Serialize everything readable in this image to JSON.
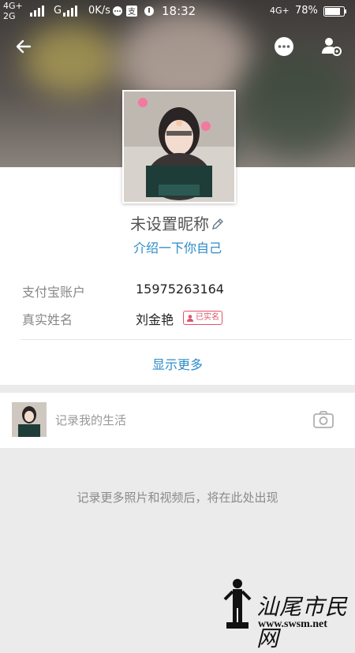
{
  "status_bar": {
    "network_1": "4G+",
    "network_2": "2G",
    "carrier_g": "G",
    "speed": "0K/s",
    "time": "18:32",
    "network_right": "4G+",
    "battery": "78%"
  },
  "profile": {
    "nickname": "未设置昵称",
    "intro": "介绍一下你自己"
  },
  "info": {
    "alipay_label": "支付宝账户",
    "alipay_value": "15975263164",
    "realname_label": "真实姓名",
    "realname_value": "刘金艳",
    "verified_badge": "已实名"
  },
  "show_more": "显示更多",
  "life": {
    "prompt": "记录我的生活"
  },
  "empty_hint": "记录更多照片和视频后，将在此处出现",
  "watermark": {
    "text": "汕尾市民网",
    "url": "www.swsm.net"
  },
  "colors": {
    "accent": "#2b8bc9",
    "badge": "#e0526b"
  }
}
